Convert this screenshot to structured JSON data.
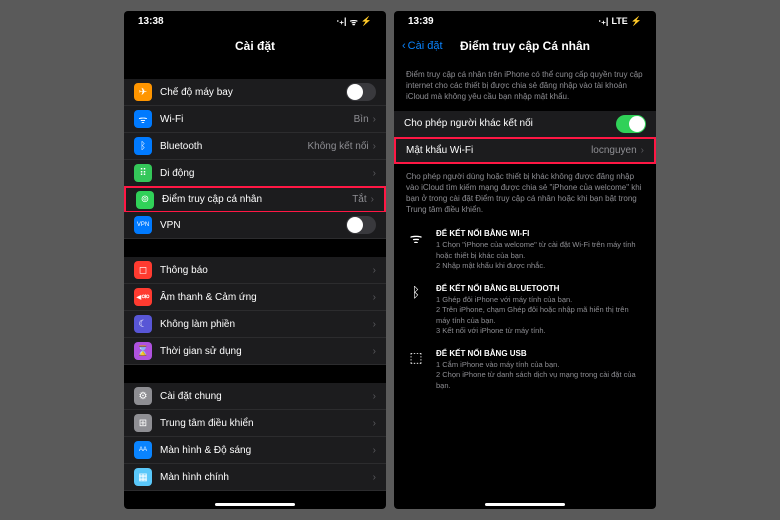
{
  "left": {
    "time": "13:38",
    "signal": "⋅₊|",
    "wifi": "ᯤ",
    "battery": "⚡",
    "title": "Cài đặt",
    "sections": [
      [
        {
          "icon": "✈",
          "bg": "bg-orange",
          "label": "Chế độ máy bay",
          "toggle": "off"
        },
        {
          "icon": "ᯤ",
          "bg": "bg-blue",
          "label": "Wi-Fi",
          "value": "Bìn"
        },
        {
          "icon": "ᛒ",
          "bg": "bg-blue",
          "label": "Bluetooth",
          "value": "Không kết nối"
        },
        {
          "icon": "⠿",
          "bg": "bg-green",
          "label": "Di động",
          "value": ""
        },
        {
          "icon": "⊚",
          "bg": "bg-green2",
          "label": "Điểm truy cập cá nhân",
          "value": "Tắt",
          "highlight": true
        },
        {
          "icon": "VPN",
          "bg": "bg-blue",
          "label": "VPN",
          "toggle": "off",
          "small": true
        }
      ],
      [
        {
          "icon": "◻",
          "bg": "bg-red",
          "label": "Thông báo",
          "value": ""
        },
        {
          "icon": "◂⚮",
          "bg": "bg-red",
          "label": "Âm thanh & Cảm ứng",
          "value": ""
        },
        {
          "icon": "☾",
          "bg": "bg-purple",
          "label": "Không làm phiền",
          "value": ""
        },
        {
          "icon": "⌛",
          "bg": "bg-purple2",
          "label": "Thời gian sử dụng",
          "value": ""
        }
      ],
      [
        {
          "icon": "⚙",
          "bg": "bg-gray",
          "label": "Cài đặt chung",
          "value": ""
        },
        {
          "icon": "⊞",
          "bg": "bg-gray",
          "label": "Trung tâm điều khiển",
          "value": ""
        },
        {
          "icon": "AA",
          "bg": "bg-blue2",
          "label": "Màn hình & Độ sáng",
          "value": "",
          "small": true
        },
        {
          "icon": "▦",
          "bg": "bg-teal",
          "label": "Màn hình chính",
          "value": ""
        }
      ]
    ]
  },
  "right": {
    "time": "13:39",
    "lte": "LTE",
    "battery": "⚡",
    "back": "Cài đặt",
    "title": "Điểm truy cập Cá nhân",
    "desc1": "Điểm truy cập cá nhân trên iPhone có thể cung cấp quyền truy cập internet cho các thiết bị được chia sẻ đăng nhập vào tài khoản iCloud mà không yêu cầu bạn nhập mật khẩu.",
    "allow": {
      "label": "Cho phép người khác kết nối"
    },
    "password": {
      "label": "Mật khẩu Wi-Fi",
      "value": "locnguyen"
    },
    "desc2": "Cho phép người dùng hoặc thiết bị khác không được đăng nhập vào iCloud tìm kiếm mạng được chia sẻ \"iPhone của welcome\" khi bạn ở trong cài đặt Điểm truy cập cá nhân hoặc khi bạn bật trong Trung tâm điều khiển.",
    "wifi": {
      "title": "ĐỂ KẾT NỐI BẰNG WI-FI",
      "lines": [
        "1 Chọn \"iPhone của welcome\" từ cài đặt Wi-Fi trên máy tính hoặc thiết bị khác của bạn.",
        "2 Nhập mật khẩu khi được nhắc."
      ]
    },
    "bt": {
      "title": "ĐỂ KẾT NỐI BẰNG BLUETOOTH",
      "lines": [
        "1 Ghép đôi iPhone với máy tính của bạn.",
        "2 Trên iPhone, chạm Ghép đôi hoặc nhập mã hiển thị trên máy tính của bạn.",
        "3 Kết nối với iPhone từ máy tính."
      ]
    },
    "usb": {
      "title": "ĐỂ KẾT NỐI BẰNG USB",
      "lines": [
        "1 Cắm iPhone vào máy tính của bạn.",
        "2 Chọn iPhone từ danh sách dịch vụ mạng trong cài đặt của bạn."
      ]
    }
  }
}
